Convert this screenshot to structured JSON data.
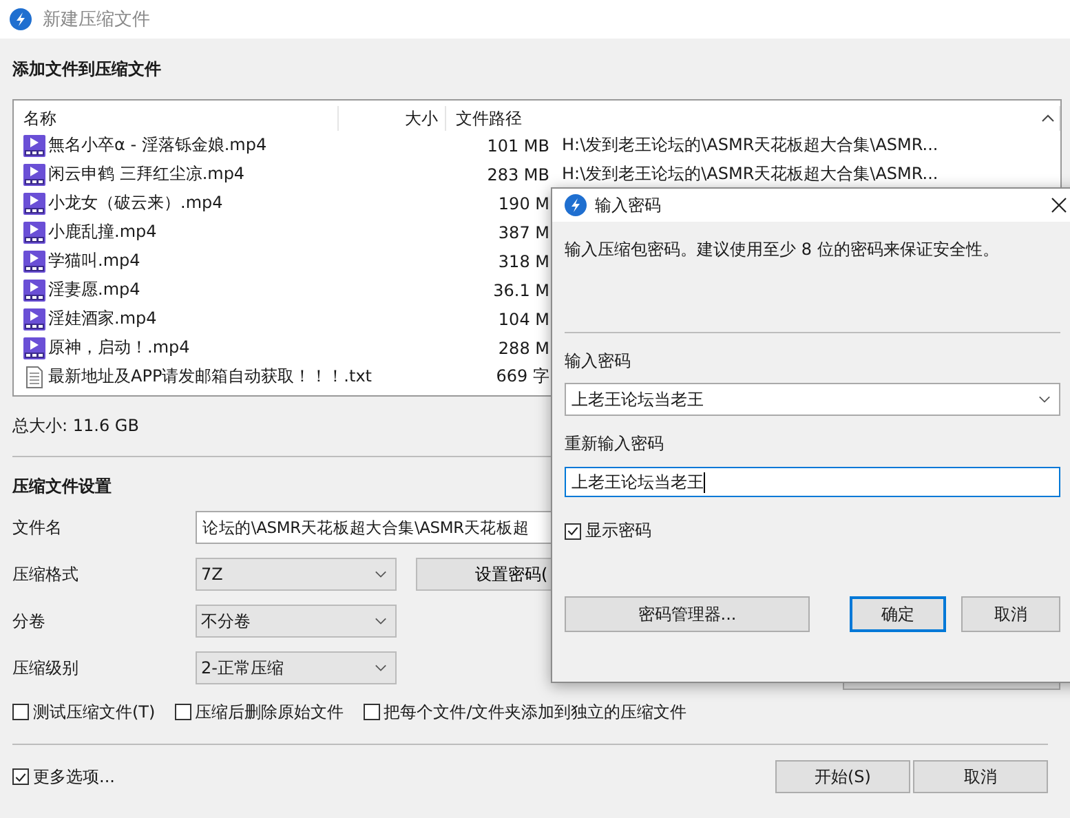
{
  "window": {
    "title": "新建压缩文件"
  },
  "files_section": {
    "heading": "添加文件到压缩文件",
    "columns": [
      "名称",
      "大小",
      "文件路径"
    ],
    "rows": [
      {
        "kind": "video",
        "name": "無名小卒α - 淫落铄金娘.mp4",
        "size": "101 MB",
        "path": "H:\\发到老王论坛的\\ASMR天花板超大合集\\ASMR..."
      },
      {
        "kind": "video",
        "name": "闲云申鹤 三拜红尘凉.mp4",
        "size": "283 MB",
        "path": "H:\\发到老王论坛的\\ASMR天花板超大合集\\ASMR..."
      },
      {
        "kind": "video",
        "name": "小龙女（破云来）.mp4",
        "size": "190 M"
      },
      {
        "kind": "video",
        "name": "小鹿乱撞.mp4",
        "size": "387 M"
      },
      {
        "kind": "video",
        "name": "学猫叫.mp4",
        "size": "318 M"
      },
      {
        "kind": "video",
        "name": "淫妻愿.mp4",
        "size": "36.1 M"
      },
      {
        "kind": "video",
        "name": "淫娃酒家.mp4",
        "size": "104 M"
      },
      {
        "kind": "video",
        "name": "原神，启动！.mp4",
        "size": "288 M"
      },
      {
        "kind": "text",
        "name": "最新地址及APP请发邮箱自动获取！！！.txt",
        "size": "669 字"
      }
    ],
    "total": "总大小: 11.6 GB"
  },
  "settings": {
    "heading": "压缩文件设置",
    "fields": [
      {
        "kind": "text",
        "label": "文件名",
        "value": "论坛的\\ASMR天花板超大合集\\ASMR天花板超"
      },
      {
        "kind": "select",
        "label": "压缩格式",
        "value": "7Z",
        "button": "设置密码("
      },
      {
        "kind": "select",
        "label": "分卷",
        "value": "不分卷"
      },
      {
        "kind": "select",
        "label": "压缩级别",
        "value": "2-正常压缩"
      }
    ],
    "options": [
      {
        "label": "测试压缩文件(T)",
        "checked": false
      },
      {
        "label": "压缩后删除原始文件",
        "checked": false
      },
      {
        "label": "把每个文件/文件夹添加到独立的压缩文件",
        "checked": false
      }
    ]
  },
  "footer": {
    "more_options": {
      "label": "更多选项...",
      "checked": true
    },
    "buttons": [
      "开始(S)",
      "取消"
    ]
  },
  "password_dialog": {
    "title": "输入密码",
    "description": "输入压缩包密码。建议使用至少 8 位的密码来保证安全性。",
    "password": {
      "label": "输入密码",
      "value": "上老王论坛当老王"
    },
    "confirm": {
      "label": "重新输入密码",
      "value": "上老王论坛当老王",
      "focused": true
    },
    "show_password": {
      "label": "显示密码",
      "checked": true
    },
    "buttons": [
      {
        "label": "密码管理器...",
        "focused": false
      },
      {
        "label": "确定",
        "focused": true
      },
      {
        "label": "取消",
        "focused": false
      }
    ]
  }
}
